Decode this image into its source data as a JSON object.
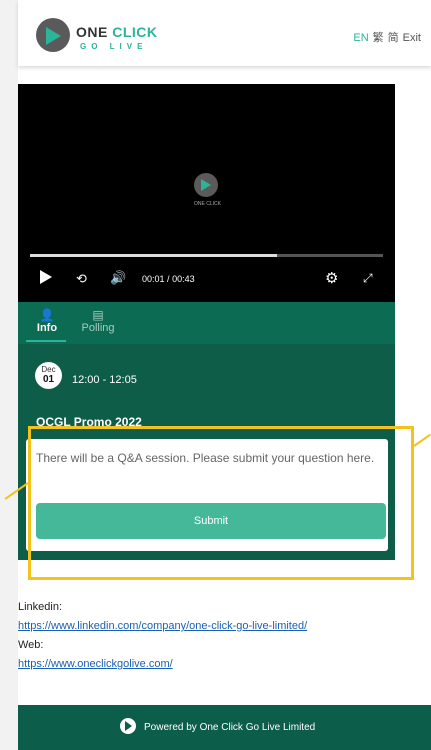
{
  "header": {
    "logo_one": "ONE",
    "logo_click": "CLICK",
    "logo_go": "GO LIVE",
    "lang_en": "EN",
    "lang_trad": "繁",
    "lang_simp": "简",
    "exit": "Exit"
  },
  "player": {
    "logo_text": "ONE CLICK",
    "current_time": "00:01",
    "separator": "/",
    "duration": "00:43",
    "progress_fraction": 0.7
  },
  "tabs": [
    {
      "label": "Info",
      "active": true
    },
    {
      "label": "Polling",
      "active": false
    }
  ],
  "event": {
    "month": "Dec",
    "day": "01",
    "time_range": "12:00  -  12:05",
    "title": "OCGL Promo 2022"
  },
  "qa": {
    "message": "There will be a Q&A session. Please submit your question here.",
    "submit_label": "Submit"
  },
  "links": {
    "linkedin_label": "Linkedin:",
    "linkedin_url": "https://www.linkedin.com/company/one-click-go-live-limited/",
    "web_label": "Web:",
    "web_url": "https://www.oneclickgolive.com/"
  },
  "footer": {
    "powered_by": "Powered by One Click Go Live Limited"
  },
  "colors": {
    "accent": "#2bb49a",
    "dark_green": "#0c5d4a",
    "highlight": "#f3c21b"
  }
}
